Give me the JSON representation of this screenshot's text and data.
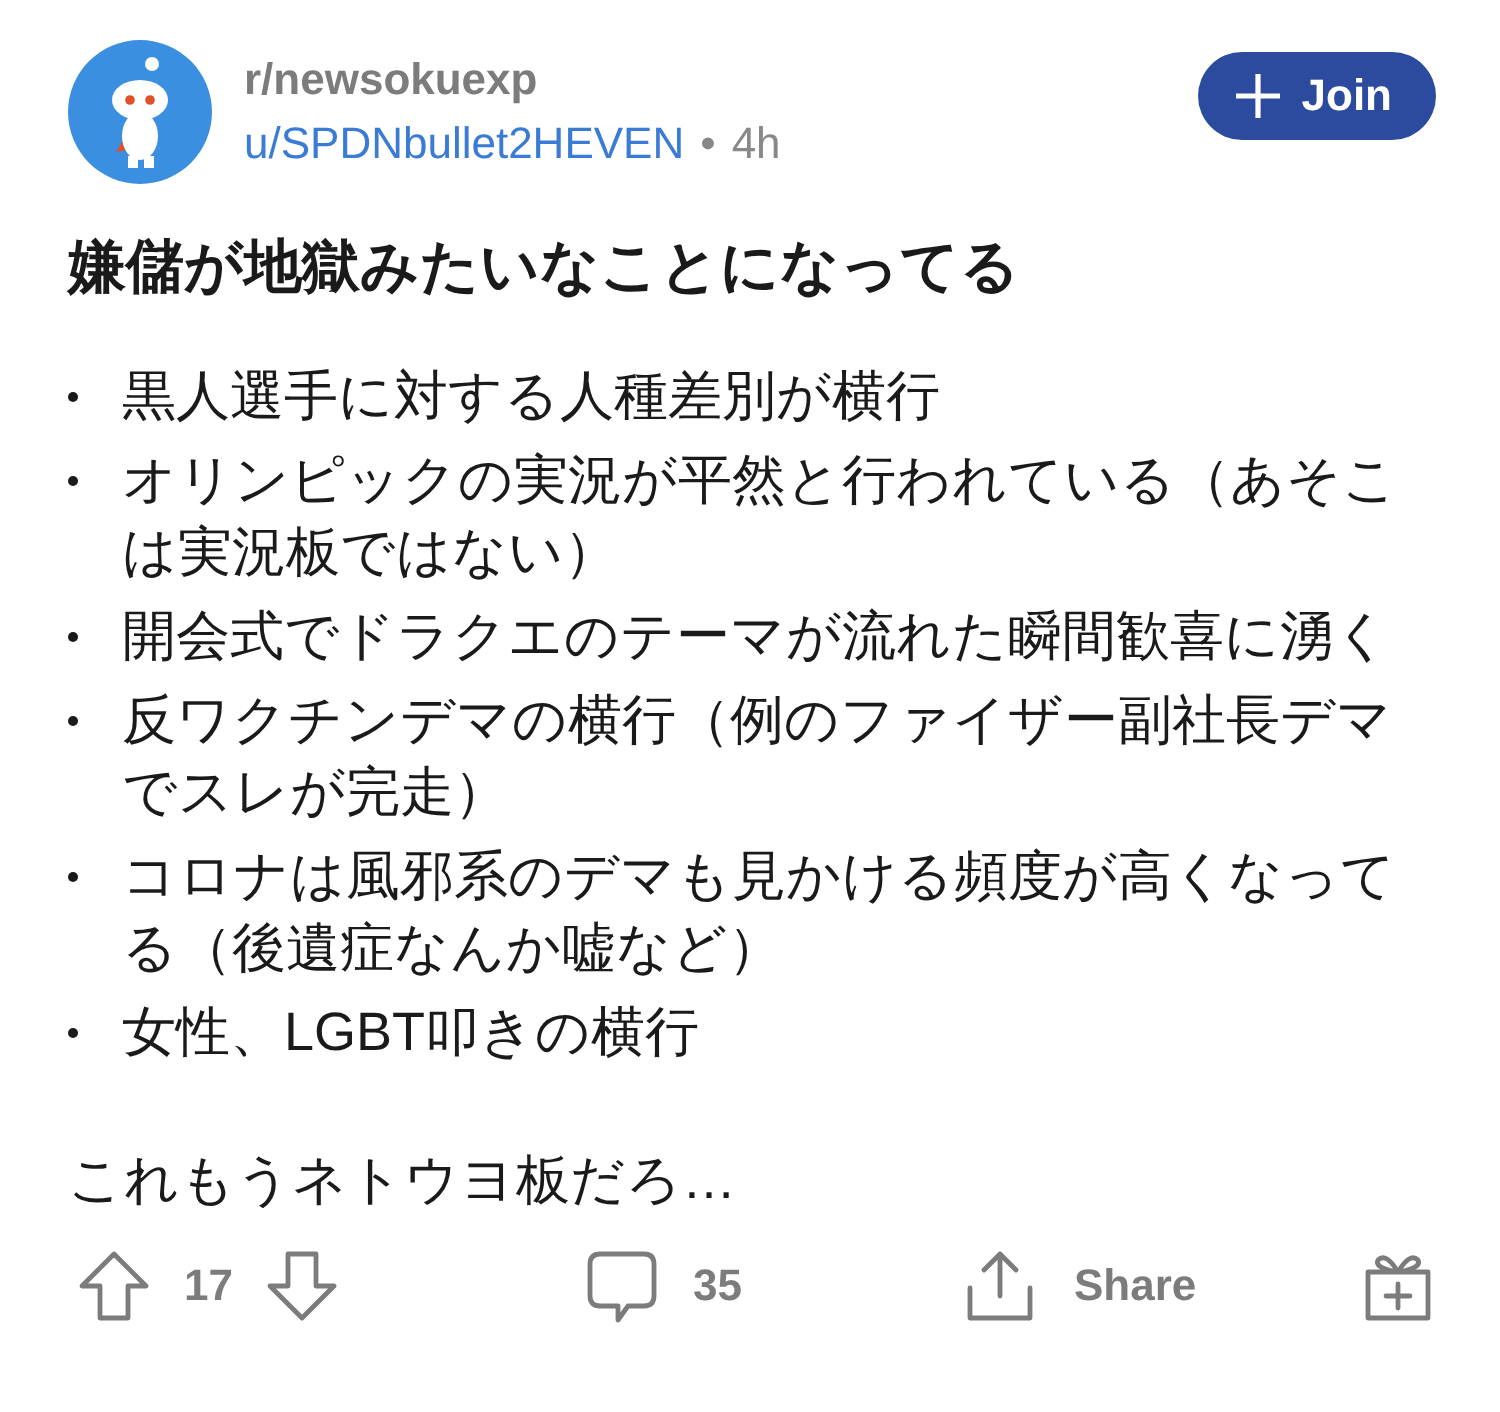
{
  "post": {
    "subreddit": "r/newsokuexp",
    "author": "u/SPDNbullet2HEVEN",
    "separator": "•",
    "age": "4h",
    "join_button": "Join"
  },
  "title": "嫌儲が地獄みたいなことになってる",
  "bullets": [
    "黒人選手に対する人種差別が横行",
    "オリンピックの実況が平然と行われている（あそこは実況板ではない）",
    "開会式でドラクエのテーマが流れた瞬間歓喜に湧く",
    "反ワクチンデマの横行（例のファイザー副社長デマでスレが完走）",
    "コロナは風邪系のデマも見かける頻度が高くなってる（後遺症なんか嘘など）",
    "女性、LGBT叩きの横行"
  ],
  "closing": "これもうネトウヨ板だろ…",
  "actions": {
    "votes": "17",
    "comments": "35",
    "share": "Share"
  }
}
